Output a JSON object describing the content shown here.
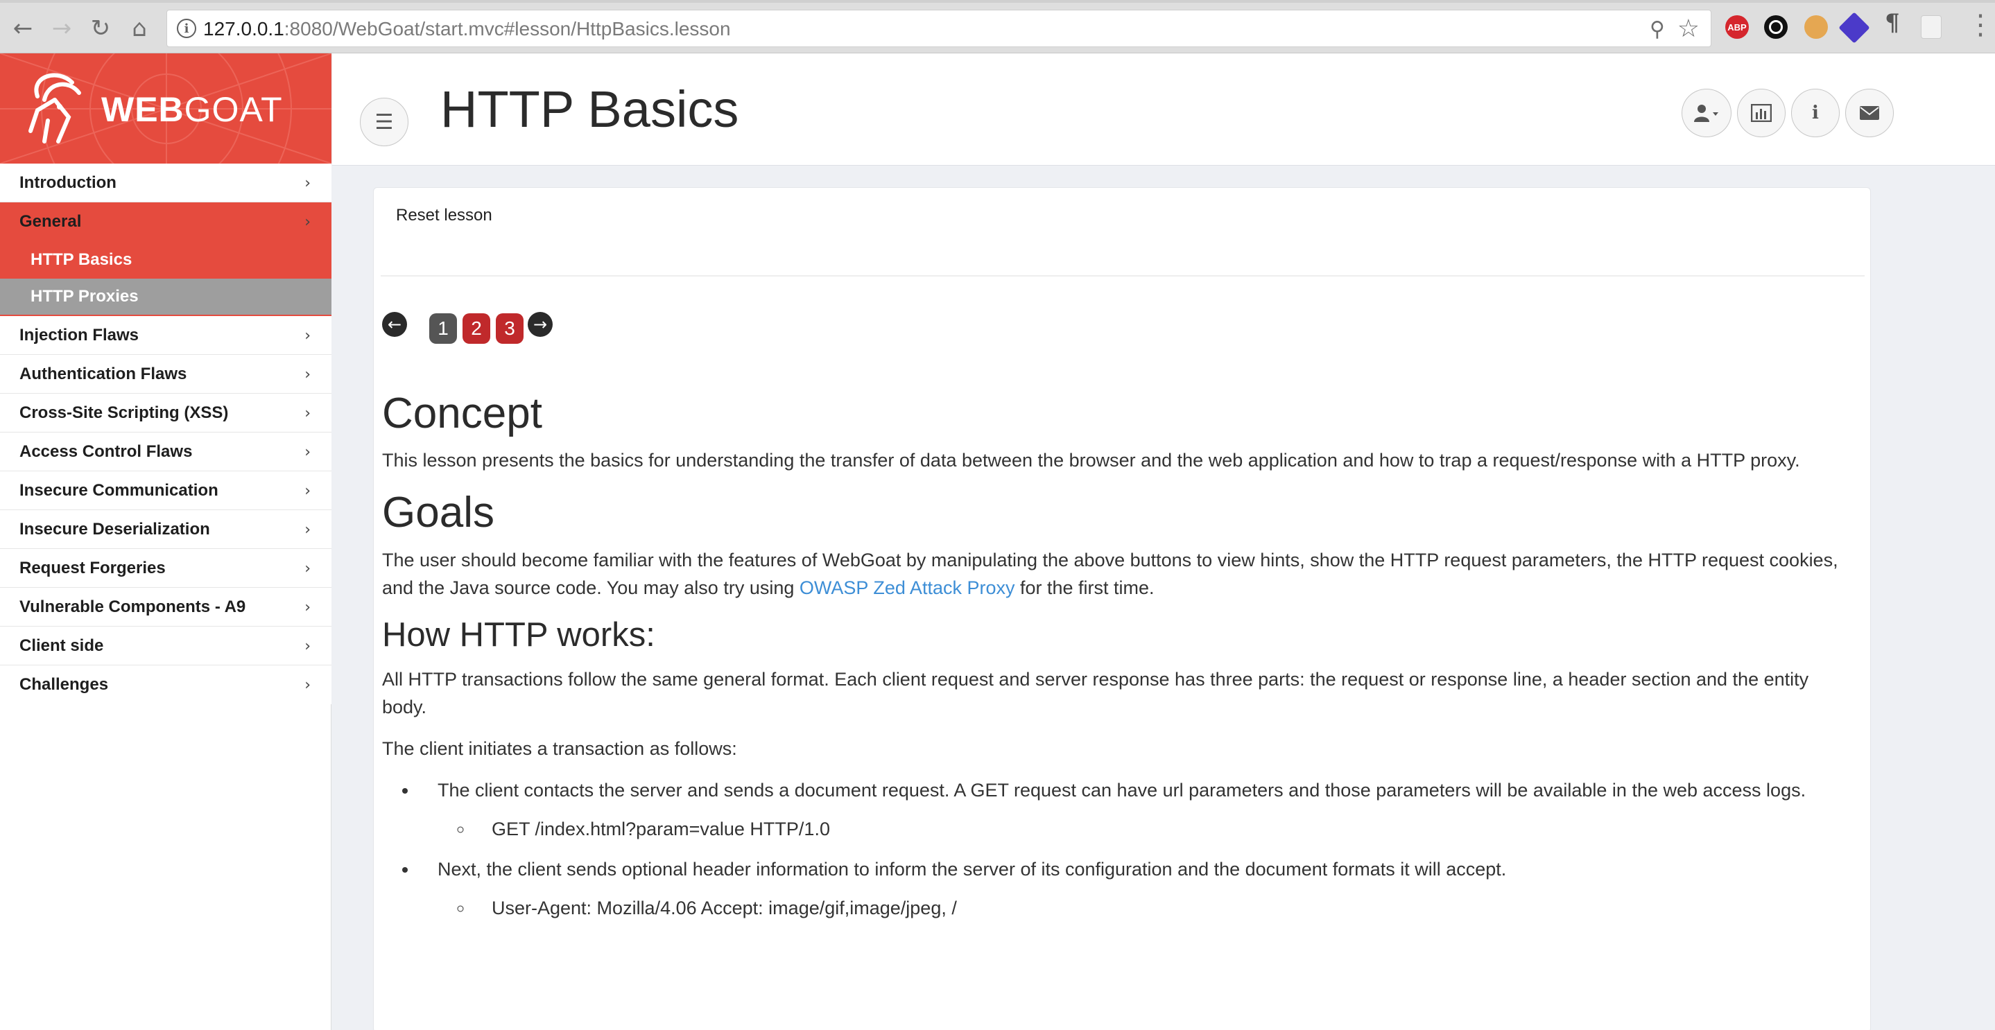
{
  "browser": {
    "url_host": "127.0.0.1",
    "url_rest": ":8080/WebGoat/start.mvc#lesson/HttpBasics.lesson",
    "extensions": [
      "ABP"
    ]
  },
  "brand": {
    "name_bold": "WEB",
    "name_light": "GOAT",
    "color": "#e54b3e"
  },
  "sidebar": {
    "items_before": [
      {
        "label": "Introduction"
      }
    ],
    "active": {
      "label": "General",
      "subitems": [
        {
          "label": "HTTP Basics",
          "current": true
        },
        {
          "label": "HTTP Proxies",
          "current": false
        }
      ]
    },
    "items_after": [
      {
        "label": "Injection Flaws"
      },
      {
        "label": "Authentication Flaws"
      },
      {
        "label": "Cross-Site Scripting (XSS)"
      },
      {
        "label": "Access Control Flaws"
      },
      {
        "label": "Insecure Communication"
      },
      {
        "label": "Insecure Deserialization"
      },
      {
        "label": "Request Forgeries"
      },
      {
        "label": "Vulnerable Components - A9"
      },
      {
        "label": "Client side"
      },
      {
        "label": "Challenges"
      }
    ]
  },
  "header": {
    "title": "HTTP Basics",
    "buttons": [
      "user-icon",
      "chart-icon",
      "info-icon",
      "envelope-icon"
    ]
  },
  "lesson": {
    "reset_label": "Reset lesson",
    "pages": [
      {
        "number": "1",
        "done": true
      },
      {
        "number": "2",
        "done": false
      },
      {
        "number": "3",
        "done": false
      }
    ],
    "concept_heading": "Concept",
    "concept_text": "This lesson presents the basics for understanding the transfer of data between the browser and the web application and how to trap a request/response with a HTTP proxy.",
    "goals_heading": "Goals",
    "goals_text_before": "The user should become familiar with the features of WebGoat by manipulating the above buttons to view hints, show the HTTP request parameters, the HTTP request cookies, and the Java source code. You may also try using ",
    "goals_link": "OWASP Zed Attack Proxy",
    "goals_text_after": " for the first time.",
    "how_heading": "How HTTP works:",
    "how_text": "All HTTP transactions follow the same general format. Each client request and server response has three parts: the request or response line, a header section and the entity body.",
    "initiates_text": "The client initiates a transaction as follows:",
    "bullet1": "The client contacts the server and sends a document request. A GET request can have url parameters and those parameters will be available in the web access logs.",
    "bullet1_sub": "GET /index.html?param=value HTTP/1.0",
    "bullet2": "Next, the client sends optional header information to inform the server of its configuration and the document formats it will accept.",
    "bullet2_sub": "User-Agent: Mozilla/4.06 Accept: image/gif,image/jpeg, /"
  }
}
